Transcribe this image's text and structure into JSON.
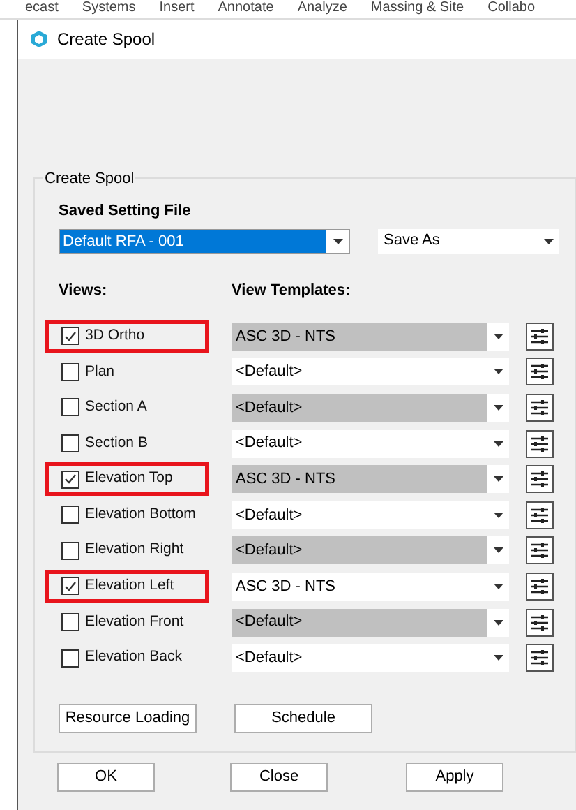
{
  "ribbon_tabs": [
    "ecast",
    "Systems",
    "Insert",
    "Annotate",
    "Analyze",
    "Massing & Site",
    "Collabo"
  ],
  "window": {
    "title": "Create Spool"
  },
  "group": {
    "title": "Create Spool"
  },
  "saved_setting_file": {
    "label": "Saved Setting File",
    "value": "Default RFA - 001",
    "save_as": "Save As"
  },
  "views_header": "Views:",
  "templates_header": "View Templates:",
  "views": [
    {
      "name": "3D Ortho",
      "checked": true,
      "highlighted": true,
      "template": "ASC 3D - NTS",
      "shaded": true
    },
    {
      "name": "Plan",
      "checked": false,
      "highlighted": false,
      "template": "<Default>",
      "shaded": false
    },
    {
      "name": "Section A",
      "checked": false,
      "highlighted": false,
      "template": "<Default>",
      "shaded": true
    },
    {
      "name": "Section B",
      "checked": false,
      "highlighted": false,
      "template": "<Default>",
      "shaded": false
    },
    {
      "name": "Elevation Top",
      "checked": true,
      "highlighted": true,
      "template": "ASC 3D - NTS",
      "shaded": true
    },
    {
      "name": "Elevation Bottom",
      "checked": false,
      "highlighted": false,
      "template": "<Default>",
      "shaded": false
    },
    {
      "name": "Elevation Right",
      "checked": false,
      "highlighted": false,
      "template": "<Default>",
      "shaded": true
    },
    {
      "name": "Elevation Left",
      "checked": true,
      "highlighted": true,
      "template": "ASC 3D - NTS",
      "shaded": false
    },
    {
      "name": "Elevation Front",
      "checked": false,
      "highlighted": false,
      "template": "<Default>",
      "shaded": true
    },
    {
      "name": "Elevation Back",
      "checked": false,
      "highlighted": false,
      "template": "<Default>",
      "shaded": false
    }
  ],
  "group_buttons": [
    "Resource Loading",
    "Schedule"
  ],
  "footer_buttons": [
    "OK",
    "Close",
    "Apply"
  ]
}
